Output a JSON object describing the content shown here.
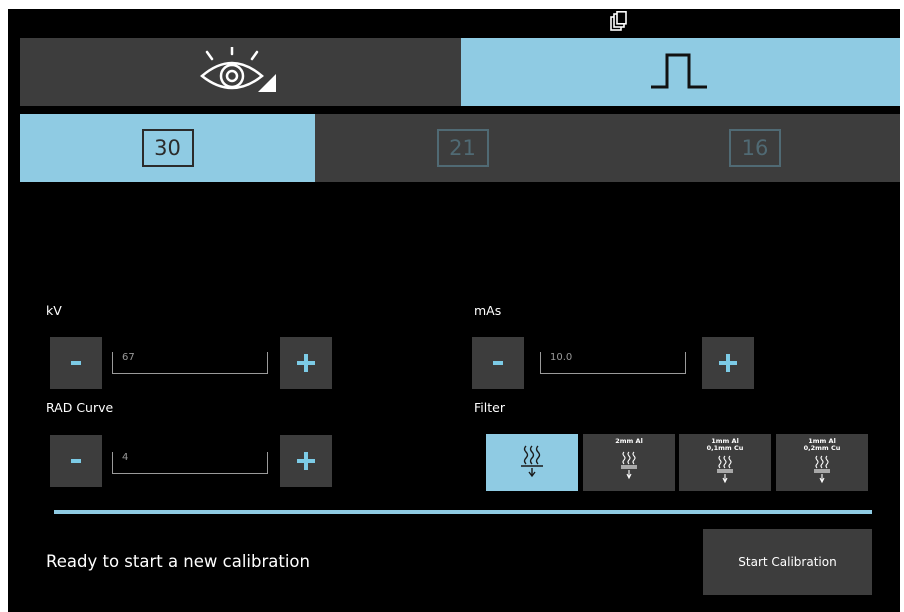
{
  "header": {
    "copy_icon": "copy-icon"
  },
  "mode_tabs": [
    {
      "icon": "eye-icon",
      "selected": false
    },
    {
      "icon": "pulse-icon",
      "selected": true
    }
  ],
  "pulse_tabs": [
    {
      "value": "30",
      "selected": true
    },
    {
      "value": "21",
      "selected": false
    },
    {
      "value": "16",
      "selected": false
    }
  ],
  "kv": {
    "label": "kV",
    "value": "67",
    "minus": "-",
    "plus": "+"
  },
  "mas": {
    "label": "mAs",
    "value": "10.0",
    "minus": "-",
    "plus": "+"
  },
  "rad_curve": {
    "label": "RAD Curve",
    "value": "4",
    "minus": "-",
    "plus": "+"
  },
  "filter": {
    "label": "Filter",
    "options": [
      {
        "line1": "",
        "line2": "",
        "selected": true
      },
      {
        "line1": "2mm Al",
        "line2": "",
        "selected": false
      },
      {
        "line1": "1mm Al",
        "line2": "0,1mm Cu",
        "selected": false
      },
      {
        "line1": "1mm Al",
        "line2": "0,2mm Cu",
        "selected": false
      }
    ]
  },
  "status": {
    "text": "Ready to start a new calibration"
  },
  "start_button": {
    "label": "Start Calibration"
  },
  "colors": {
    "accent": "#8fcbe3",
    "panel": "#3d3d3d",
    "background": "#000000",
    "icon_blue": "#7ccbe6",
    "disabled_text": "#506a74"
  }
}
